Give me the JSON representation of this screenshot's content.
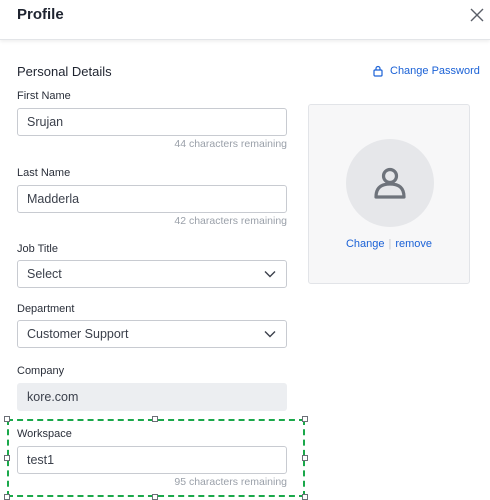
{
  "header": {
    "title": "Profile"
  },
  "personal": {
    "section_title": "Personal Details",
    "change_password": "Change Password",
    "first_name": {
      "label": "First Name",
      "value": "Srujan",
      "helper": "44 characters remaining"
    },
    "last_name": {
      "label": "Last Name",
      "value": "Madderla",
      "helper": "42 characters remaining"
    },
    "job_title": {
      "label": "Job Title",
      "value": "Select"
    },
    "department": {
      "label": "Department",
      "value": "Customer Support"
    },
    "company": {
      "label": "Company",
      "value": "kore.com"
    },
    "workspace": {
      "label": "Workspace",
      "value": "test1",
      "helper": "95 characters remaining"
    }
  },
  "avatar": {
    "change_label": "Change",
    "separator": "|",
    "remove_label": "remove"
  },
  "icons": [
    "close-icon",
    "lock-icon",
    "chevron-down-icon",
    "user-icon"
  ],
  "colors": {
    "accent": "#1a61d6",
    "selection": "#1aa84a"
  }
}
